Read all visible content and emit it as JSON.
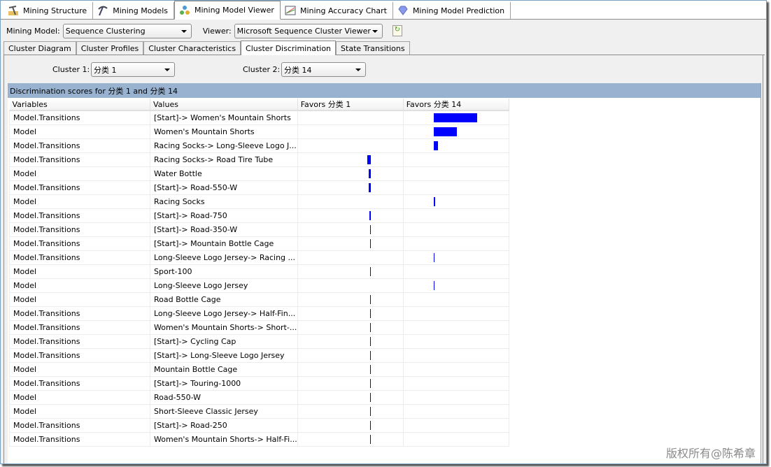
{
  "doc_tabs": [
    {
      "label": "Mining Structure",
      "icon": "pickaxe-structure-icon",
      "active": false
    },
    {
      "label": "Mining Models",
      "icon": "pickaxe-icon",
      "active": false
    },
    {
      "label": "Mining Model Viewer",
      "icon": "model-viewer-icon",
      "active": true
    },
    {
      "label": "Mining Accuracy Chart",
      "icon": "accuracy-chart-icon",
      "active": false
    },
    {
      "label": "Mining Model Prediction",
      "icon": "diamond-icon",
      "active": false
    }
  ],
  "toolbar": {
    "mining_model_label": "Mining Model:",
    "mining_model_value": "Sequence Clustering",
    "viewer_label": "Viewer:",
    "viewer_value": "Microsoft Sequence Cluster Viewer",
    "refresh_icon": "refresh-icon"
  },
  "sub_tabs": [
    {
      "label": "Cluster Diagram",
      "active": false
    },
    {
      "label": "Cluster Profiles",
      "active": false
    },
    {
      "label": "Cluster Characteristics",
      "active": false
    },
    {
      "label": "Cluster Discrimination",
      "active": true
    },
    {
      "label": "State Transitions",
      "active": false
    }
  ],
  "cluster_select": {
    "cluster1_label": "Cluster 1:",
    "cluster1_value": "分类 1",
    "cluster2_label": "Cluster 2:",
    "cluster2_value": "分类 14"
  },
  "caption": "Discrimination scores for 分类 1 and 分类 14",
  "table": {
    "headers": [
      "Variables",
      "Values",
      "Favors 分类 1",
      "Favors 分类 14"
    ],
    "bar_color": "#0000ff",
    "rows": [
      {
        "variable": "Model.Transitions",
        "value": "[Start]-> Women's Mountain Shorts",
        "favors": 2,
        "score": 100
      },
      {
        "variable": "Model",
        "value": "Women's Mountain Shorts",
        "favors": 2,
        "score": 53
      },
      {
        "variable": "Model.Transitions",
        "value": "Racing Socks-> Long-Sleeve Logo J...",
        "favors": 2,
        "score": 10
      },
      {
        "variable": "Model.Transitions",
        "value": "Racing Socks-> Road Tire Tube",
        "favors": 1,
        "score": 8
      },
      {
        "variable": "Model",
        "value": "Water Bottle",
        "favors": 1,
        "score": 5
      },
      {
        "variable": "Model.Transitions",
        "value": "[Start]-> Road-550-W",
        "favors": 1,
        "score": 5
      },
      {
        "variable": "Model",
        "value": "Racing Socks",
        "favors": 2,
        "score": 4
      },
      {
        "variable": "Model.Transitions",
        "value": "[Start]-> Road-750",
        "favors": 1,
        "score": 4
      },
      {
        "variable": "Model.Transitions",
        "value": "[Start]-> Road-350-W",
        "favors": 1,
        "score": 2
      },
      {
        "variable": "Model.Transitions",
        "value": "[Start]-> Mountain Bottle Cage",
        "favors": 1,
        "score": 2
      },
      {
        "variable": "Model.Transitions",
        "value": "Long-Sleeve Logo Jersey-> Racing ...",
        "favors": 2,
        "score": 2
      },
      {
        "variable": "Model",
        "value": "Sport-100",
        "favors": 1,
        "score": 2
      },
      {
        "variable": "Model",
        "value": "Long-Sleeve Logo Jersey",
        "favors": 2,
        "score": 2
      },
      {
        "variable": "Model",
        "value": "Road Bottle Cage",
        "favors": 1,
        "score": 2
      },
      {
        "variable": "Model.Transitions",
        "value": "Long-Sleeve Logo Jersey-> Half-Fin...",
        "favors": 1,
        "score": 2
      },
      {
        "variable": "Model.Transitions",
        "value": "Women's Mountain Shorts-> Short-...",
        "favors": 1,
        "score": 2
      },
      {
        "variable": "Model.Transitions",
        "value": "[Start]-> Cycling Cap",
        "favors": 1,
        "score": 2
      },
      {
        "variable": "Model.Transitions",
        "value": "[Start]-> Long-Sleeve Logo Jersey",
        "favors": 1,
        "score": 2
      },
      {
        "variable": "Model",
        "value": "Mountain Bottle Cage",
        "favors": 1,
        "score": 2
      },
      {
        "variable": "Model.Transitions",
        "value": "[Start]-> Touring-1000",
        "favors": 1,
        "score": 1
      },
      {
        "variable": "Model",
        "value": "Road-550-W",
        "favors": 1,
        "score": 1
      },
      {
        "variable": "Model",
        "value": "Short-Sleeve Classic Jersey",
        "favors": 1,
        "score": 1
      },
      {
        "variable": "Model.Transitions",
        "value": "[Start]-> Road-250",
        "favors": 1,
        "score": 1
      },
      {
        "variable": "Model.Transitions",
        "value": "Women's Mountain Shorts-> Half-Fi...",
        "favors": 1,
        "score": 1
      }
    ]
  },
  "watermark": "版权所有@陈希章"
}
